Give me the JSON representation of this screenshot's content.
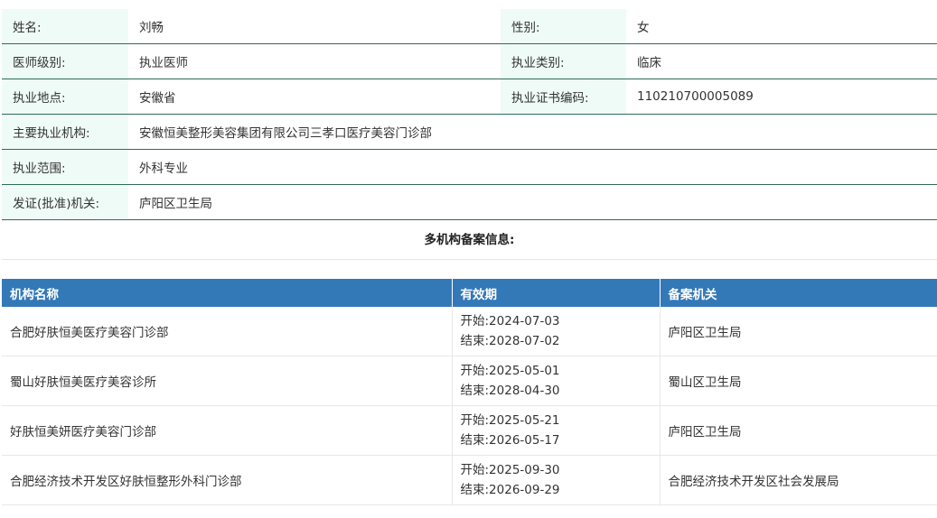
{
  "info": {
    "name_label": "姓名:",
    "name_value": "刘畅",
    "gender_label": "性别:",
    "gender_value": "女",
    "level_label": "医师级别:",
    "level_value": "执业医师",
    "category_label": "执业类别:",
    "category_value": "临床",
    "location_label": "执业地点:",
    "location_value": "安徽省",
    "cert_label": "执业证书编码:",
    "cert_value": "110210700005089",
    "institution_label": "主要执业机构:",
    "institution_value": "安徽恒美整形美容集团有限公司三孝口医疗美容门诊部",
    "scope_label": "执业范围:",
    "scope_value": "外科专业",
    "issuer_label": "发证(批准)机关:",
    "issuer_value": "庐阳区卫生局"
  },
  "multi": {
    "title": "多机构备案信息:",
    "headers": [
      "机构名称",
      "有效期",
      "备案机关"
    ],
    "rows": [
      {
        "org": "合肥好肤恒美医疗美容门诊部",
        "start": "开始:2024-07-03",
        "end": "结束:2028-07-02",
        "authority": "庐阳区卫生局"
      },
      {
        "org": "蜀山好肤恒美医疗美容诊所",
        "start": "开始:2025-05-01",
        "end": "结束:2028-04-30",
        "authority": "蜀山区卫生局"
      },
      {
        "org": "好肤恒美妍医疗美容门诊部",
        "start": "开始:2025-05-21",
        "end": "结束:2026-05-17",
        "authority": "庐阳区卫生局"
      },
      {
        "org": "合肥经济技术开发区好肤恒整形外科门诊部",
        "start": "开始:2025-09-30",
        "end": "结束:2026-09-29",
        "authority": "合肥经济技术开发区社会发展局"
      }
    ]
  }
}
